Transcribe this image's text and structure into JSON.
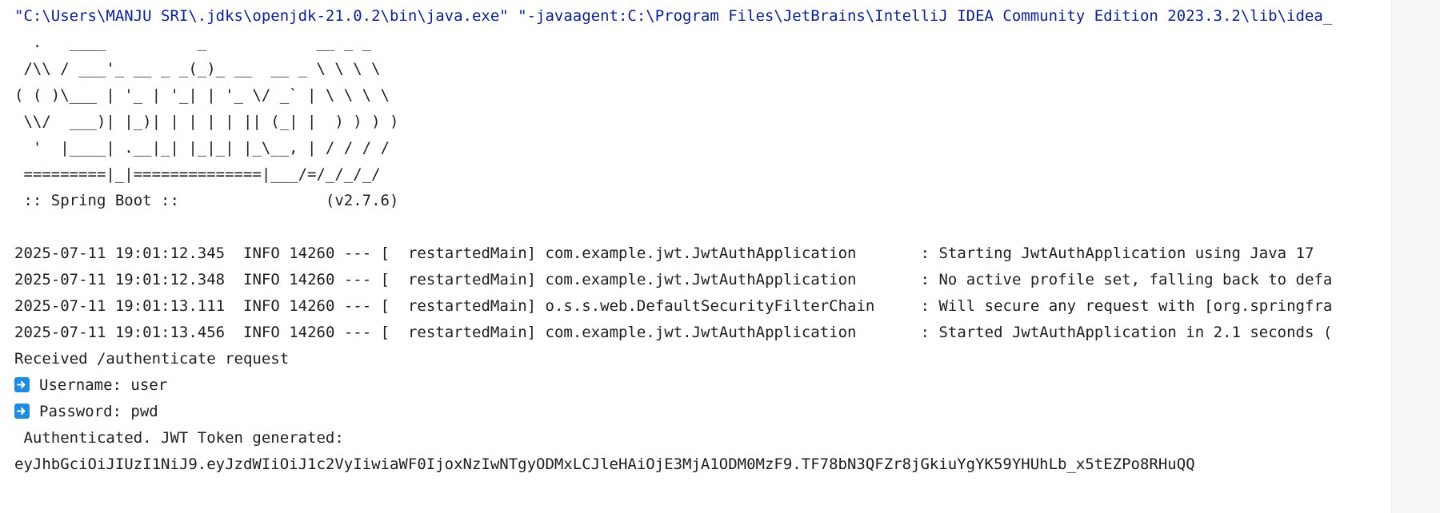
{
  "console": {
    "command_line": "\"C:\\Users\\MANJU SRI\\.jdks\\openjdk-21.0.2\\bin\\java.exe\" \"-javaagent:C:\\Program Files\\JetBrains\\IntelliJ IDEA Community Edition 2023.3.2\\lib\\idea_",
    "banner": [
      "  .   ____          _            __ _ _",
      " /\\\\ / ___'_ __ _ _(_)_ __  __ _ \\ \\ \\ \\",
      "( ( )\\___ | '_ | '_| | '_ \\/ _` | \\ \\ \\ \\",
      " \\\\/  ___)| |_)| | | | | || (_| |  ) ) ) )",
      "  '  |____| .__|_| |_|_| |_\\__, | / / / /",
      " =========|_|==============|___/=/_/_/_/",
      " :: Spring Boot ::                (v2.7.6)"
    ],
    "log_lines": [
      {
        "timestamp": "2025-07-11 19:01:12.345",
        "level": "INFO",
        "pid": "14260",
        "thread": "restartedMain",
        "logger": "com.example.jwt.JwtAuthApplication",
        "message": ": Starting JwtAuthApplication using Java 17"
      },
      {
        "timestamp": "2025-07-11 19:01:12.348",
        "level": "INFO",
        "pid": "14260",
        "thread": "restartedMain",
        "logger": "com.example.jwt.JwtAuthApplication",
        "message": ": No active profile set, falling back to defa"
      },
      {
        "timestamp": "2025-07-11 19:01:13.111",
        "level": "INFO",
        "pid": "14260",
        "thread": "restartedMain",
        "logger": "o.s.s.web.DefaultSecurityFilterChain",
        "message": ": Will secure any request with [org.springfra"
      },
      {
        "timestamp": "2025-07-11 19:01:13.456",
        "level": "INFO",
        "pid": "14260",
        "thread": "restartedMain",
        "logger": "com.example.jwt.JwtAuthApplication",
        "message": ": Started JwtAuthApplication in 2.1 seconds ("
      }
    ],
    "received": "Received /authenticate request",
    "username_line": "Username: user",
    "password_line": "Password: pwd",
    "authenticated": " Authenticated. JWT Token generated:",
    "token": "eyJhbGciOiJIUzI1NiJ9.eyJzdWIiOiJ1c2VyIiwiaWF0IjoxNzIwNTgyODMxLCJleHAiOjE3MjA1ODM0MzF9.TF78bN3QFZr8jGkiuYgYK59YHUhLb_x5tEZPo8RHuQQ"
  },
  "colors": {
    "command": "#0b1f8f",
    "text": "#1e1e1e",
    "arrow_badge": "#1f8ce0"
  },
  "icons": {
    "arrow": "right-arrow-icon"
  }
}
